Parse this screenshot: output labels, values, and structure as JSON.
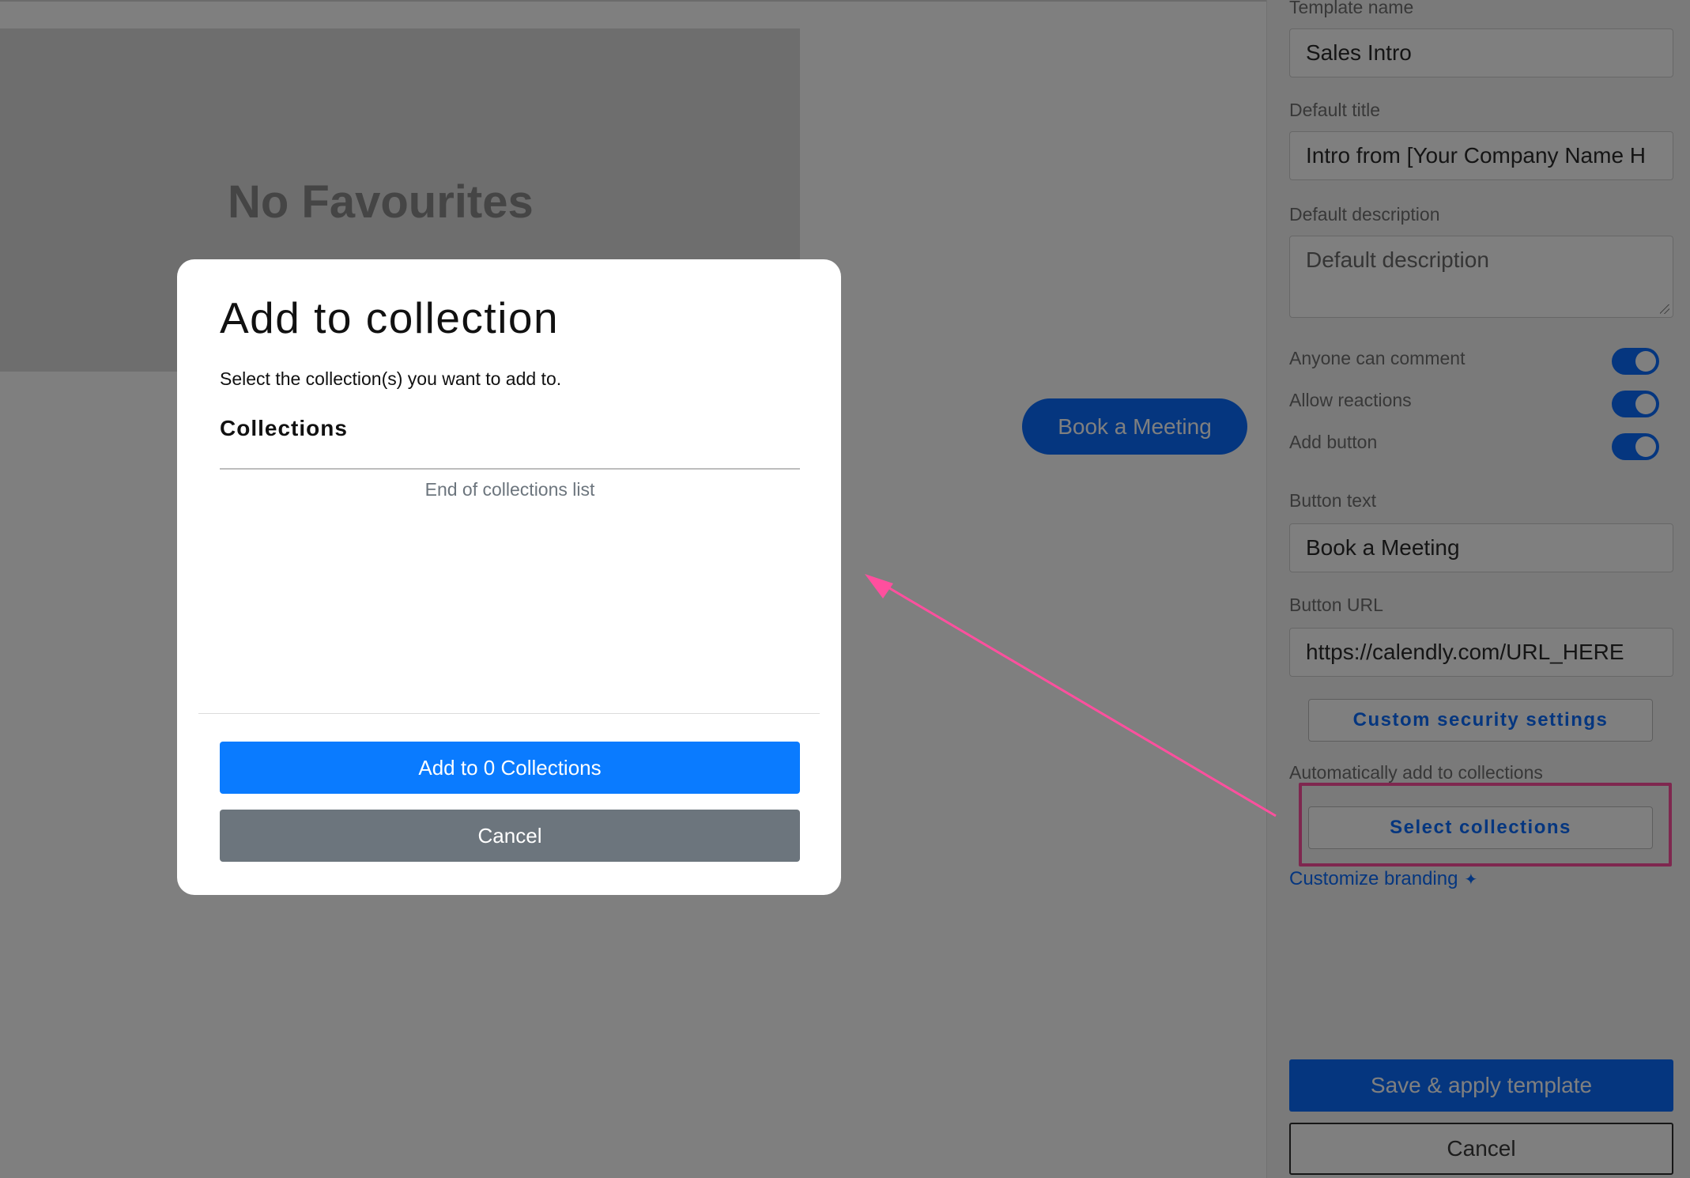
{
  "background": {
    "favourites_empty_title": "No Favourites",
    "book_meeting_button": "Book a Meeting"
  },
  "sidebar": {
    "template_name_label": "Template name",
    "template_name_value": "Sales Intro",
    "default_title_label": "Default title",
    "default_title_value": "Intro from [Your Company Name H",
    "default_description_label": "Default description",
    "default_description_placeholder": "Default description",
    "toggles": [
      {
        "label": "Anyone can comment",
        "on": true
      },
      {
        "label": "Allow reactions",
        "on": true
      },
      {
        "label": "Add button",
        "on": true
      }
    ],
    "button_text_label": "Button text",
    "button_text_value": "Book a Meeting",
    "button_url_label": "Button URL",
    "button_url_value": "https://calendly.com/URL_HERE",
    "custom_security_button": "Custom security settings",
    "auto_collections_label": "Automatically add to collections",
    "select_collections_button": "Select collections",
    "customize_branding_link": "Customize branding",
    "save_button": "Save & apply template",
    "cancel_button": "Cancel"
  },
  "modal": {
    "title": "Add to collection",
    "subtitle": "Select the collection(s) you want to add to.",
    "section_heading": "Collections",
    "list_end_text": "End of collections list",
    "add_button": "Add to 0 Collections",
    "cancel_button": "Cancel"
  },
  "colors": {
    "accent_blue": "#0a6cff",
    "annotation_pink": "#ff4f9e",
    "cancel_gray": "#6c757d"
  }
}
